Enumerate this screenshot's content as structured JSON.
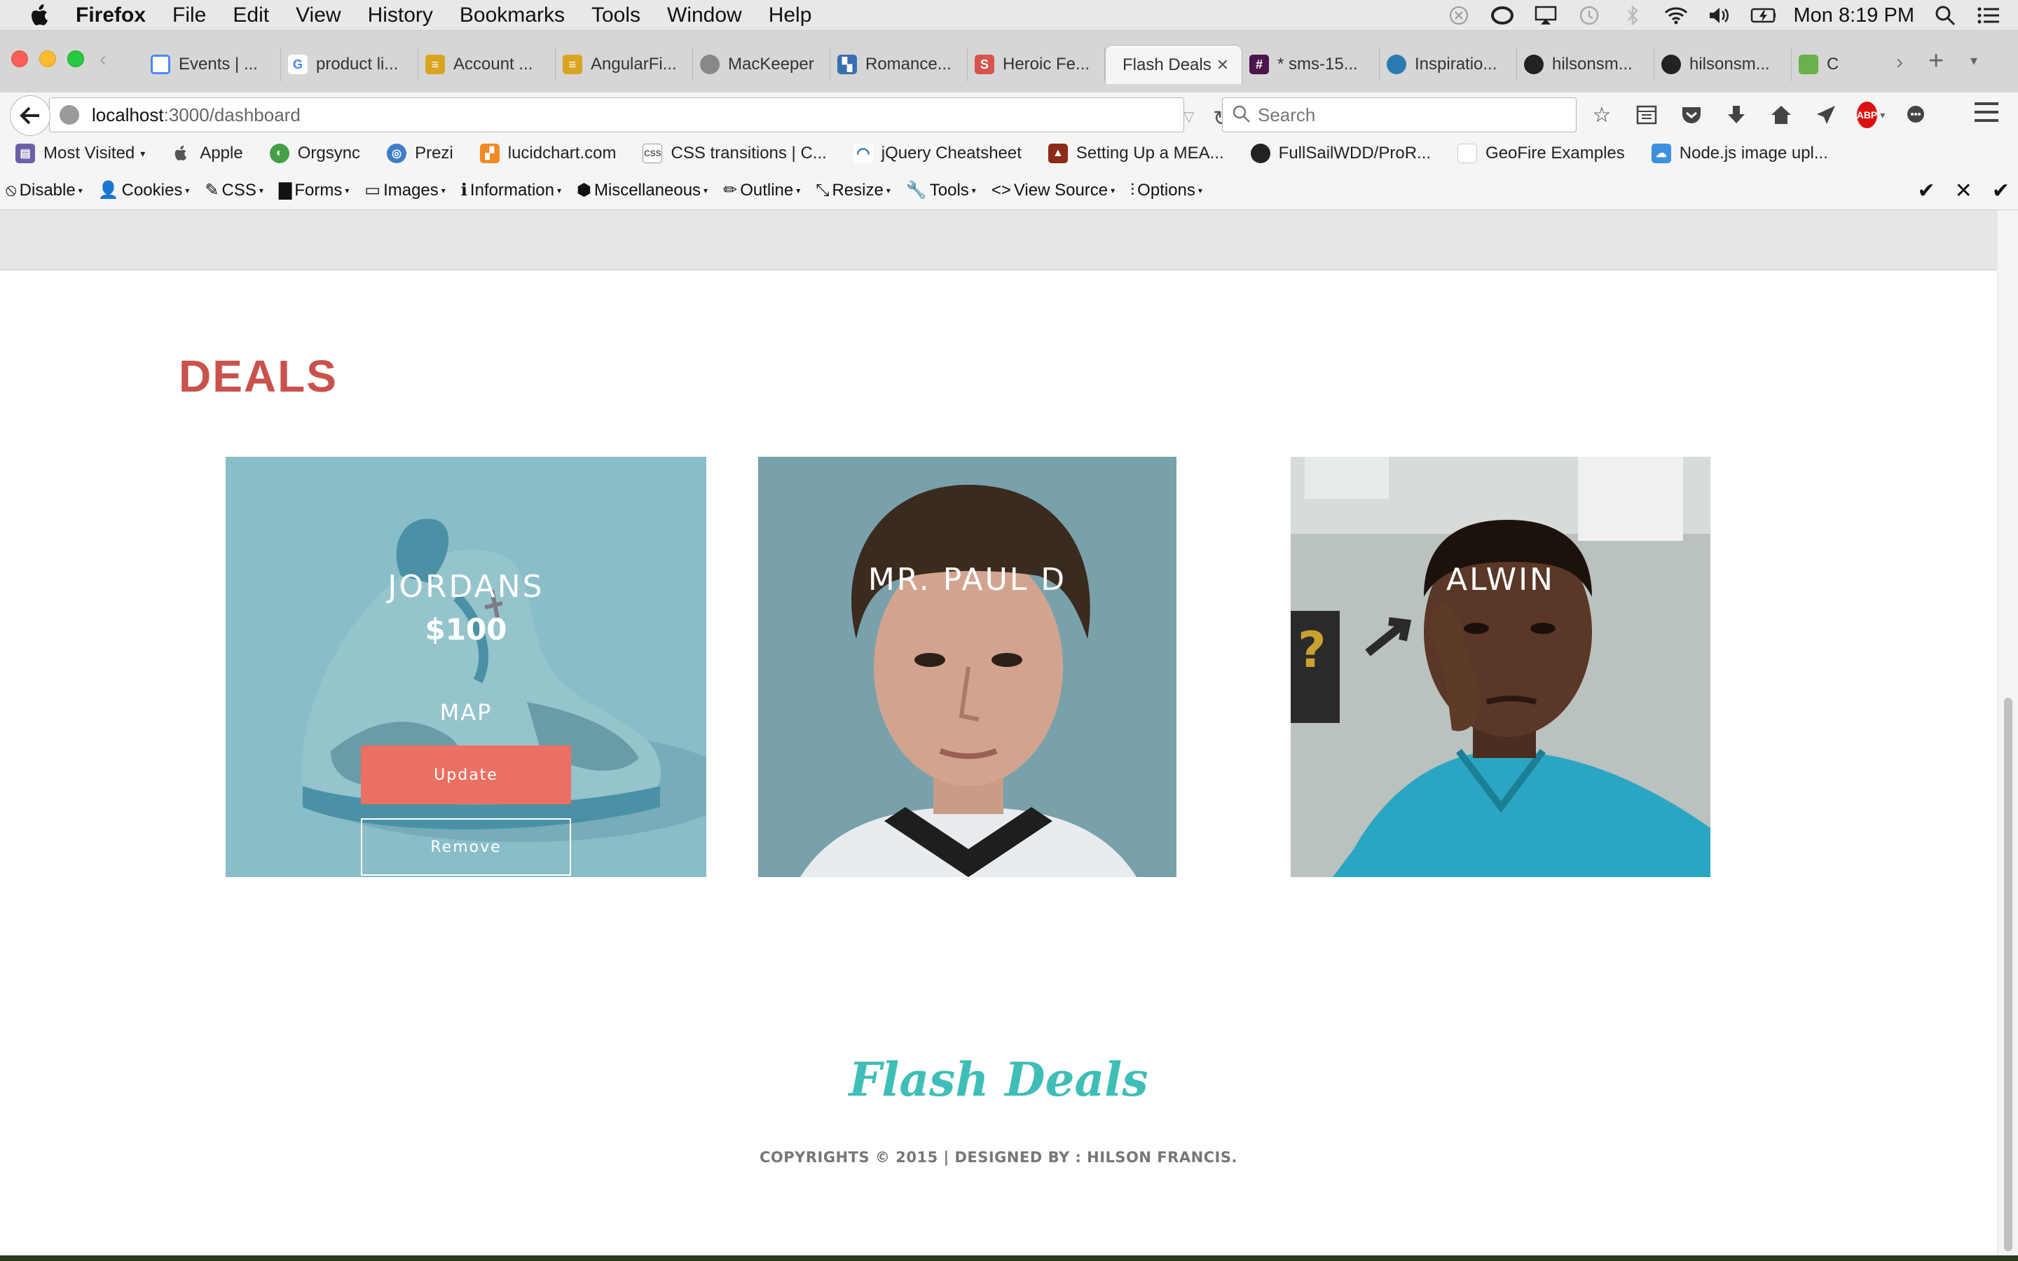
{
  "menubar": {
    "app_name": "Firefox",
    "items": [
      "File",
      "Edit",
      "View",
      "History",
      "Bookmarks",
      "Tools",
      "Window",
      "Help"
    ],
    "clock": "Mon 8:19 PM"
  },
  "tabs": [
    {
      "label": "Events | ...",
      "icon": "google-events-icon",
      "color": "#4a8af4"
    },
    {
      "label": "product li...",
      "icon": "google-icon",
      "color": "#4285f4"
    },
    {
      "label": "Account ...",
      "icon": "database-icon",
      "color": "#d9a520"
    },
    {
      "label": "AngularFi...",
      "icon": "database-icon",
      "color": "#d9a520"
    },
    {
      "label": "MacKeeper",
      "icon": "mackeeper-icon",
      "color": "#888888"
    },
    {
      "label": "Romance...",
      "icon": "clapper-icon",
      "color": "#3a6fb0"
    },
    {
      "label": "Heroic Fe...",
      "icon": "s-icon",
      "color": "#d9534f"
    },
    {
      "label": "Flash Deals",
      "icon": "",
      "color": "",
      "active": true
    },
    {
      "label": "* sms-15...",
      "icon": "slack-hash-icon",
      "color": "#4a154b"
    },
    {
      "label": "Inspiratio...",
      "icon": "drop-icon",
      "color": "#2a7ab0"
    },
    {
      "label": "hilsonsm...",
      "icon": "github-icon",
      "color": "#222222"
    },
    {
      "label": "hilsonsm...",
      "icon": "github-icon",
      "color": "#222222"
    },
    {
      "label": "C",
      "icon": "chart-icon",
      "color": "#6ab04c"
    }
  ],
  "navbar": {
    "url_host": "localhost",
    "url_path": ":3000/dashboard",
    "search_placeholder": "Search"
  },
  "bookmarks": [
    {
      "label": "Most Visited",
      "icon": "most-visited-icon",
      "color": "#6d5fa8",
      "dropdown": true
    },
    {
      "label": "Apple",
      "icon": "apple-icon",
      "color": "#555555"
    },
    {
      "label": "Orgsync",
      "icon": "orgsync-icon",
      "color": "#43a047"
    },
    {
      "label": "Prezi",
      "icon": "prezi-icon",
      "color": "#3d7ec7"
    },
    {
      "label": "lucidchart.com",
      "icon": "lucidchart-icon",
      "color": "#f08a24"
    },
    {
      "label": "CSS transitions | C...",
      "icon": "css3-icon",
      "color": "#888888"
    },
    {
      "label": "jQuery Cheatsheet",
      "icon": "jquery-icon",
      "color": "#1e6fb0"
    },
    {
      "label": "Setting Up a MEA...",
      "icon": "mean-icon",
      "color": "#8b2b1a"
    },
    {
      "label": "FullSailWDD/ProR...",
      "icon": "github-icon",
      "color": "#222222"
    },
    {
      "label": "GeoFire Examples",
      "icon": "blank-page-icon",
      "color": "#dddddd"
    },
    {
      "label": "Node.js image upl...",
      "icon": "cloud-upload-icon",
      "color": "#3d8fe0"
    }
  ],
  "devbar": {
    "items": [
      {
        "label": "Disable",
        "icon": "⦸"
      },
      {
        "label": "Cookies",
        "icon": "👤"
      },
      {
        "label": "CSS",
        "icon": "✎"
      },
      {
        "label": "Forms",
        "icon": "▇"
      },
      {
        "label": "Images",
        "icon": "▭"
      },
      {
        "label": "Information",
        "icon": "ℹ"
      },
      {
        "label": "Miscellaneous",
        "icon": "⬢"
      },
      {
        "label": "Outline",
        "icon": "✏"
      },
      {
        "label": "Resize",
        "icon": "⤡"
      },
      {
        "label": "Tools",
        "icon": "🔧"
      },
      {
        "label": "View Source",
        "icon": "<>"
      },
      {
        "label": "Options",
        "icon": "⫶"
      }
    ]
  },
  "page": {
    "heading": "DEALS",
    "deals": [
      {
        "name": "JORDANS",
        "price": "$100",
        "map_label": "MAP",
        "update_label": "Update",
        "remove_label": "Remove"
      },
      {
        "name": "MR. PAUL D"
      },
      {
        "name": "ALWIN"
      }
    ],
    "footer_logo": "Flash Deals",
    "footer_copyright": "COPYRIGHTS © 2015 | DESIGNED BY : HILSON FRANCIS."
  },
  "colors": {
    "heading": "#c9524d",
    "update_button": "#ea7062",
    "card_overlay": "#5da6b5",
    "footer_logo": "#3fbdb7"
  }
}
